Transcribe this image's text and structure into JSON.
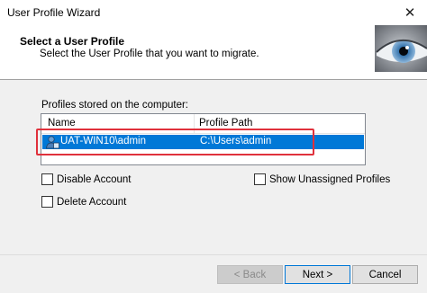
{
  "window": {
    "title": "User Profile Wizard",
    "close_glyph": "✕"
  },
  "header": {
    "heading": "Select a User Profile",
    "subheading": "Select the User Profile that you want to migrate.",
    "image_icon": "eye-icon"
  },
  "profiles": {
    "label": "Profiles stored on the computer:",
    "columns": [
      "Name",
      "Profile Path"
    ],
    "rows": [
      {
        "name": "UAT-WIN10\\admin",
        "path": "C:\\Users\\admin",
        "selected": true,
        "icon": "user-icon"
      }
    ],
    "selection_color": "#0078d7",
    "highlight_color": "#e0313c"
  },
  "options": {
    "disable_account": {
      "label": "Disable Account",
      "checked": false
    },
    "delete_account": {
      "label": "Delete Account",
      "checked": false
    },
    "show_unassigned": {
      "label": "Show Unassigned Profiles",
      "checked": false
    }
  },
  "buttons": {
    "back": "< Back",
    "next": "Next >",
    "cancel": "Cancel"
  }
}
